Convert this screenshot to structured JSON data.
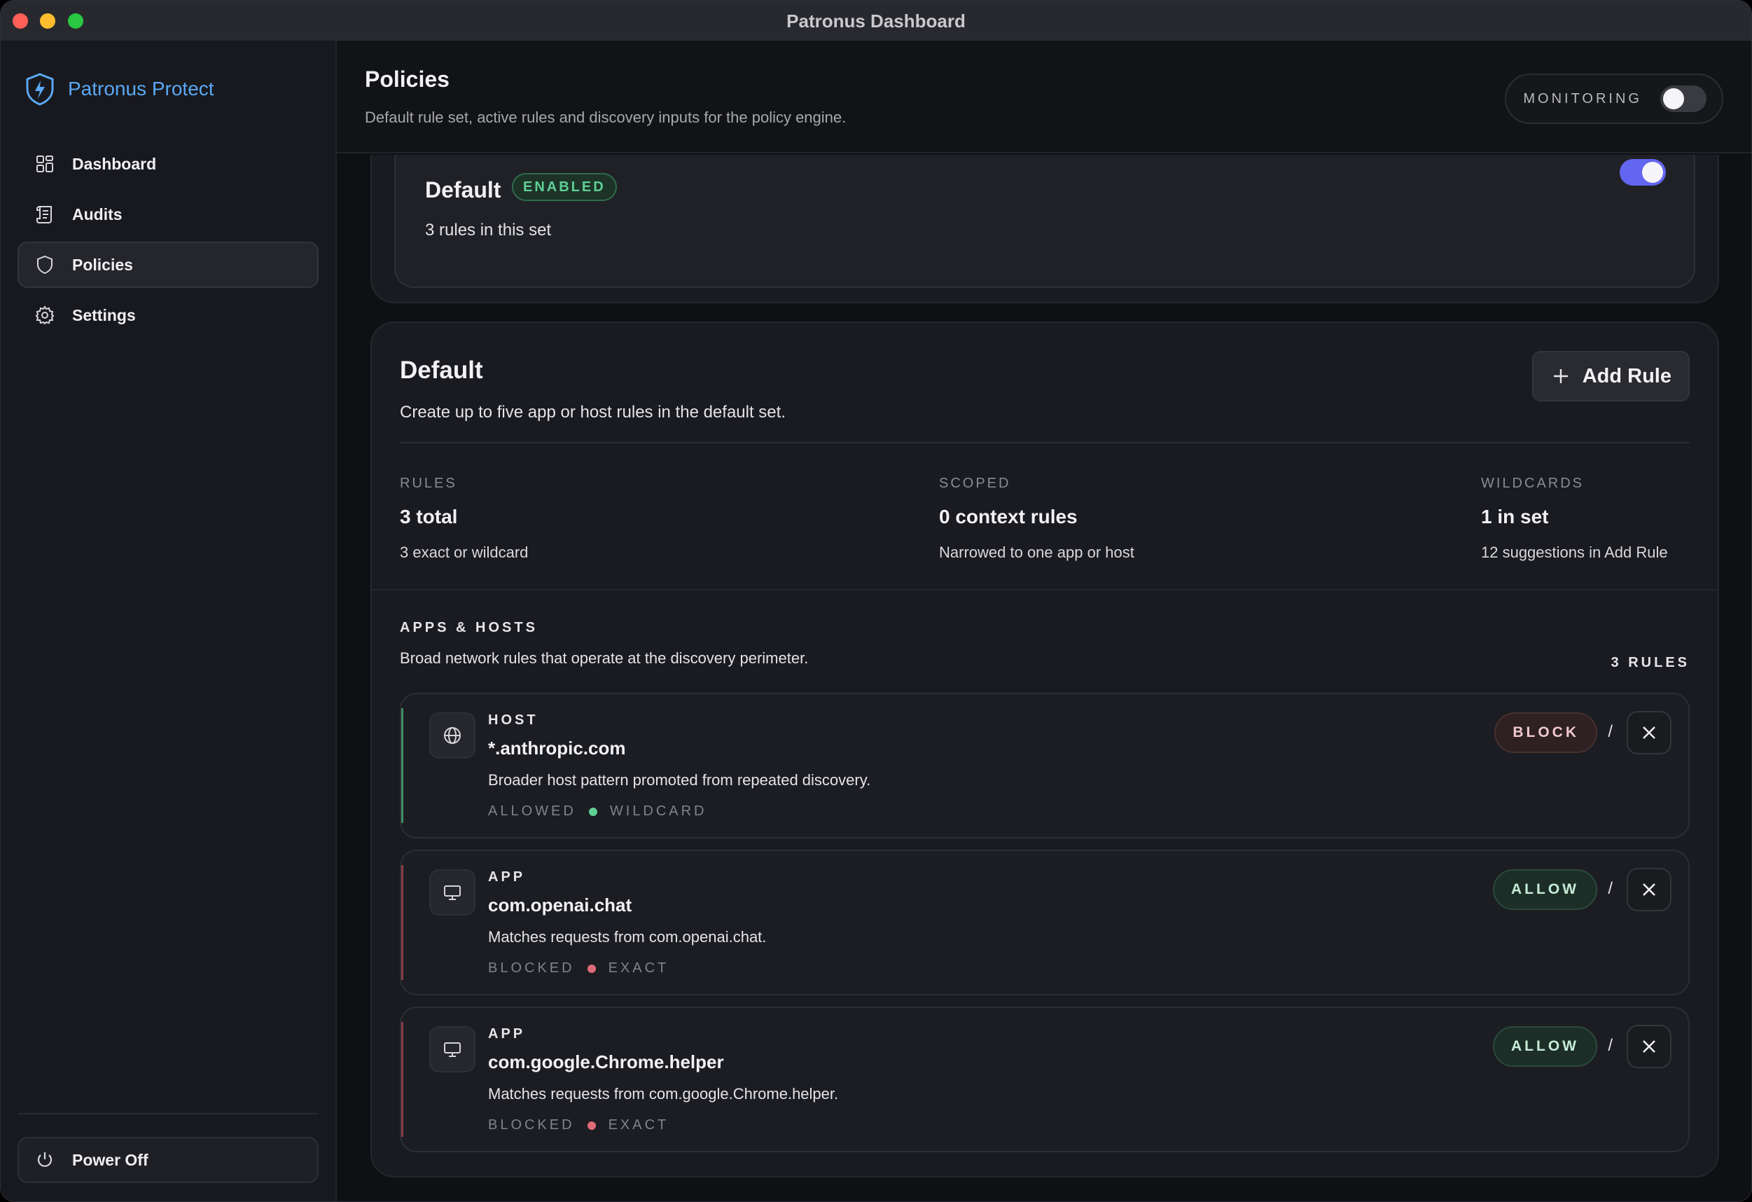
{
  "window": {
    "title": "Patronus Dashboard"
  },
  "brand": {
    "name": "Patronus Protect",
    "color": "#5aa8f5"
  },
  "sidebar": {
    "items": [
      {
        "label": "Dashboard",
        "icon": "grid-icon",
        "active": false
      },
      {
        "label": "Audits",
        "icon": "scroll-icon",
        "active": false
      },
      {
        "label": "Policies",
        "icon": "shield-icon",
        "active": true
      },
      {
        "label": "Settings",
        "icon": "gear-icon",
        "active": false
      }
    ],
    "power_label": "Power Off"
  },
  "header": {
    "title": "Policies",
    "subtitle": "Default rule set, active rules and discovery inputs for the policy engine.",
    "monitoring_label": "MONITORING",
    "monitoring_on": false
  },
  "rule_set": {
    "name": "Default",
    "badge": "ENABLED",
    "summary": "3 rules in this set",
    "enabled": true
  },
  "section": {
    "title": "Default",
    "subtitle": "Create up to five app or host rules in the default set.",
    "add_label": "Add Rule"
  },
  "stats": [
    {
      "label": "RULES",
      "value": "3 total",
      "note": "3 exact or wildcard"
    },
    {
      "label": "SCOPED",
      "value": "0 context rules",
      "note": "Narrowed to one app or host"
    },
    {
      "label": "WILDCARDS",
      "value": "1 in set",
      "note": "12 suggestions in Add Rule"
    }
  ],
  "apps_hosts": {
    "label": "APPS & HOSTS",
    "subtitle": "Broad network rules that operate at the discovery perimeter.",
    "count_label": "3 RULES"
  },
  "rules": [
    {
      "type": "HOST",
      "icon": "globe-icon",
      "name": "*.anthropic.com",
      "description": "Broader host pattern promoted from repeated discovery.",
      "status": "ALLOWED",
      "match": "WILDCARD",
      "status_color": "#5fcf94",
      "action": "BLOCK",
      "separator": "/"
    },
    {
      "type": "APP",
      "icon": "monitor-icon",
      "name": "com.openai.chat",
      "description": "Matches requests from com.openai.chat.",
      "status": "BLOCKED",
      "match": "EXACT",
      "status_color": "#e06b78",
      "action": "ALLOW",
      "separator": "/"
    },
    {
      "type": "APP",
      "icon": "monitor-icon",
      "name": "com.google.Chrome.helper",
      "description": "Matches requests from com.google.Chrome.helper.",
      "status": "BLOCKED",
      "match": "EXACT",
      "status_color": "#e06b78",
      "action": "ALLOW",
      "separator": "/"
    }
  ]
}
